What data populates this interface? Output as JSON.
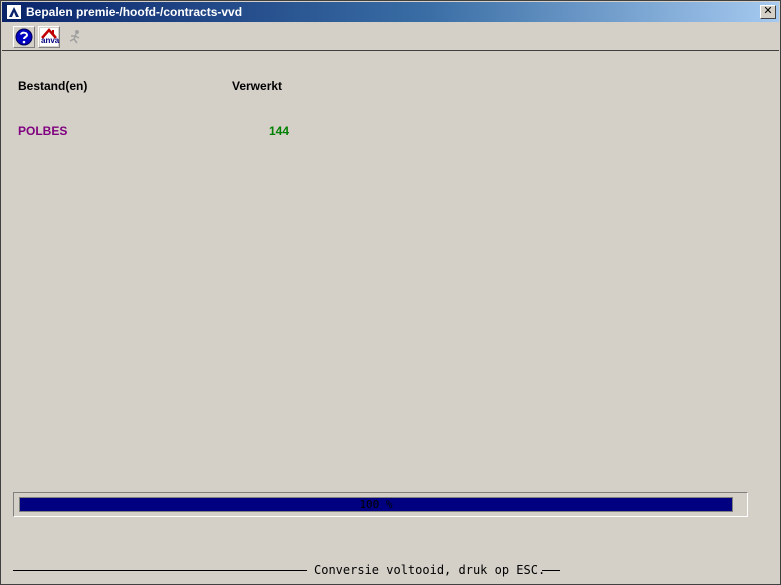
{
  "window": {
    "title": "Bepalen premie-/hoofd-/contracts-vvd",
    "close_label": "✕"
  },
  "toolbar": {
    "help_icon": "help-icon",
    "anva_icon": "anva-icon",
    "anva_text": "anva",
    "run_icon": "run-icon"
  },
  "table": {
    "headers": {
      "files": "Bestand(en)",
      "processed": "Verwerkt"
    },
    "rows": [
      {
        "name": "POLBES",
        "count": "144"
      }
    ]
  },
  "progress": {
    "value": 100,
    "label": "100 %"
  },
  "status": {
    "text": "Conversie voltooid, druk op ESC."
  },
  "colors": {
    "title_bar": "#0a246a",
    "row_name": "#800080",
    "row_count": "#008000",
    "progress_fill": "#000080"
  }
}
